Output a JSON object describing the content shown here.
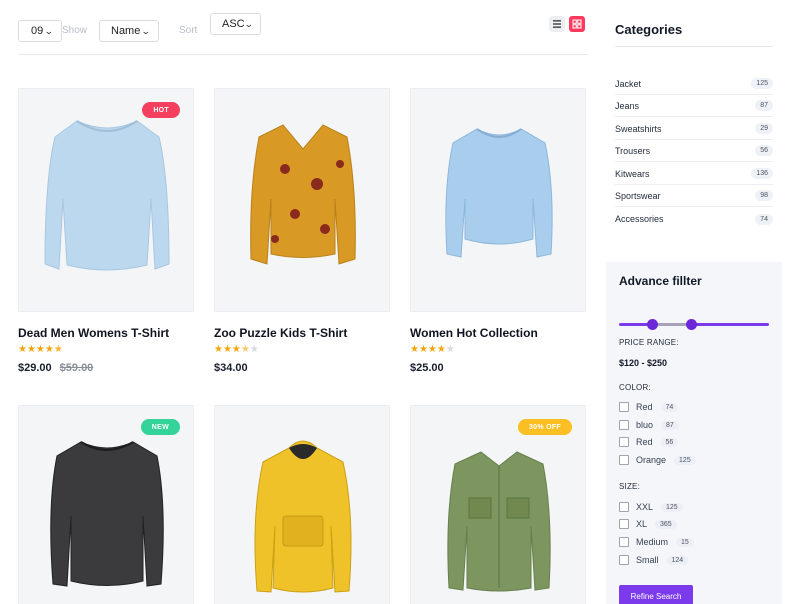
{
  "toolbar": {
    "per_page": "09",
    "show_label": "Show",
    "sort_by": "Name",
    "sort_label": "Sort",
    "order": "ASC"
  },
  "products": [
    {
      "title": "Dead Men Womens T-Shirt",
      "price": "$29.00",
      "old_price": "$59.00",
      "badge": "HOT",
      "badge_color": "#f43f5e",
      "rating": 4.5,
      "item": "blue-sweater-icon"
    },
    {
      "title": "Zoo Puzzle Kids T-Shirt",
      "price": "$34.00",
      "old_price": "",
      "badge": "",
      "rating": 3.5,
      "item": "floral-blouse-icon"
    },
    {
      "title": "Women Hot Collection",
      "price": "$25.00",
      "old_price": "",
      "badge": "",
      "rating": 4,
      "item": "knit-sweater-icon"
    },
    {
      "title": "",
      "price": "",
      "old_price": "",
      "badge": "NEW",
      "badge_color": "#34d399",
      "item": "dark-sweater-icon"
    },
    {
      "title": "",
      "price": "",
      "old_price": "",
      "badge": "",
      "item": "yellow-anorak-icon"
    },
    {
      "title": "",
      "price": "",
      "old_price": "",
      "badge": "30% OFF",
      "badge_color": "#fbbf24",
      "item": "green-jacket-icon"
    }
  ],
  "categories": {
    "heading": "Categories",
    "items": [
      {
        "label": "Jacket",
        "count": "125"
      },
      {
        "label": "Jeans",
        "count": "87"
      },
      {
        "label": "Sweatshirts",
        "count": "29"
      },
      {
        "label": "Trousers",
        "count": "56"
      },
      {
        "label": "Kitwears",
        "count": "136"
      },
      {
        "label": "Sportswear",
        "count": "98"
      },
      {
        "label": "Accessories",
        "count": "74"
      }
    ]
  },
  "filter": {
    "title": "Advance fillter",
    "price_label": "PRICE RANGE:",
    "price_range": "$120 - $250",
    "color_label": "COLOR:",
    "colors": [
      {
        "label": "Red",
        "count": "74"
      },
      {
        "label": "bluo",
        "count": "87"
      },
      {
        "label": "Red",
        "count": "56"
      },
      {
        "label": "Orange",
        "count": "125"
      }
    ],
    "size_label": "SIZE:",
    "sizes": [
      {
        "label": "XXL",
        "count": "125"
      },
      {
        "label": "XL",
        "count": "365"
      },
      {
        "label": "Medium",
        "count": "15"
      },
      {
        "label": "Small",
        "count": "124"
      }
    ],
    "button": "Refine Search"
  }
}
